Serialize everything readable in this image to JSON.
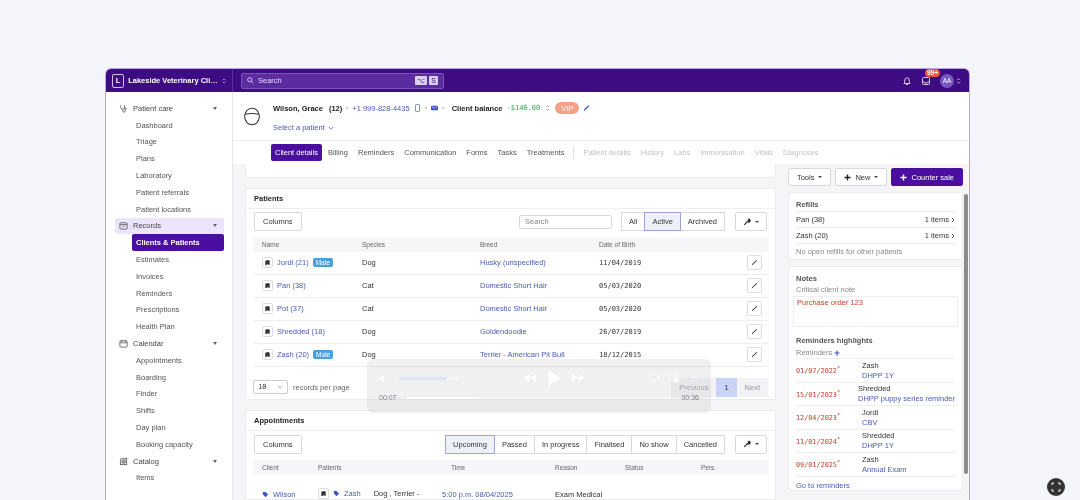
{
  "org": {
    "initial": "L",
    "name": "Lakeside Veterinary Cli…"
  },
  "search": {
    "placeholder": "Search",
    "keys": [
      "⌥",
      "S"
    ]
  },
  "notifications_badge": "99+",
  "user": {
    "initials": "AA"
  },
  "sidebar": {
    "groups": [
      {
        "label": "Patient care",
        "expanded": true,
        "selected": false,
        "items": [
          {
            "label": "Dashboard",
            "selected": false
          },
          {
            "label": "Triage",
            "selected": false
          },
          {
            "label": "Plans",
            "selected": false
          },
          {
            "label": "Laboratory",
            "selected": false
          },
          {
            "label": "Patient referrals",
            "selected": false
          },
          {
            "label": "Patient locations",
            "selected": false
          }
        ]
      },
      {
        "label": "Records",
        "expanded": true,
        "selected": true,
        "items": [
          {
            "label": "Clients & Patients",
            "selected": true
          },
          {
            "label": "Estimates",
            "selected": false
          },
          {
            "label": "Invoices",
            "selected": false
          },
          {
            "label": "Reminders",
            "selected": false
          },
          {
            "label": "Prescriptions",
            "selected": false
          },
          {
            "label": "Health Plan",
            "selected": false
          }
        ]
      },
      {
        "label": "Calendar",
        "expanded": true,
        "selected": false,
        "items": [
          {
            "label": "Appointments",
            "selected": false
          },
          {
            "label": "Boarding",
            "selected": false
          },
          {
            "label": "Finder",
            "selected": false
          },
          {
            "label": "Shifts",
            "selected": false
          },
          {
            "label": "Day plan",
            "selected": false
          },
          {
            "label": "Booking capacity",
            "selected": false
          }
        ]
      },
      {
        "label": "Catalog",
        "expanded": true,
        "selected": false,
        "items": [
          {
            "label": "Items",
            "selected": false
          }
        ]
      }
    ]
  },
  "client": {
    "name": "Wilson, Grace",
    "count": "(12)",
    "phone": "+1 999-828-4435",
    "balance_label": "Client balance",
    "balance": "-$146.00",
    "tag": "VIP",
    "patient_select": "Select a patient"
  },
  "tabs": [
    {
      "label": "Client details",
      "selected": true,
      "disabled": false
    },
    {
      "label": "Billing",
      "selected": false,
      "disabled": false
    },
    {
      "label": "Reminders",
      "selected": false,
      "disabled": false
    },
    {
      "label": "Communication",
      "selected": false,
      "disabled": false
    },
    {
      "label": "Forms",
      "selected": false,
      "disabled": false
    },
    {
      "label": "Tasks",
      "selected": false,
      "disabled": false
    },
    {
      "label": "Treatments",
      "selected": false,
      "disabled": false
    },
    {
      "label": "Patient details",
      "selected": false,
      "disabled": true
    },
    {
      "label": "History",
      "selected": false,
      "disabled": true
    },
    {
      "label": "Labs",
      "selected": false,
      "disabled": true
    },
    {
      "label": "Immunisation",
      "selected": false,
      "disabled": true
    },
    {
      "label": "Vitals",
      "selected": false,
      "disabled": true
    },
    {
      "label": "Diagnoses",
      "selected": false,
      "disabled": true
    }
  ],
  "actions": {
    "tools": "Tools",
    "new": "New",
    "counter_sale": "Counter sale"
  },
  "patients": {
    "title": "Patients",
    "columns_button": "Columns",
    "search_placeholder": "Search",
    "filters": [
      {
        "label": "All",
        "selected": false
      },
      {
        "label": "Active",
        "selected": true
      },
      {
        "label": "Archived",
        "selected": false
      }
    ],
    "columns": [
      "Name",
      "Species",
      "Breed",
      "Date of Birth"
    ],
    "rows": [
      {
        "name": "Jordi (21)",
        "tag": "Male",
        "species": "Dog",
        "breed": "Husky (unspecified)",
        "dob": "11/04/2019"
      },
      {
        "name": "Pan (38)",
        "species": "Cat",
        "breed": "Domestic Short Hair",
        "dob": "05/03/2020"
      },
      {
        "name": "Pot (37)",
        "species": "Cat",
        "breed": "Domestic Short Hair",
        "dob": "05/03/2020"
      },
      {
        "name": "Shredded (18)",
        "species": "Dog",
        "breed": "Goldendoodle",
        "dob": "26/07/2019"
      },
      {
        "name": "Zash (20)",
        "tag": "Male",
        "species": "Dog",
        "breed": "Terrier - American Pit Bull",
        "dob": "18/12/2015"
      }
    ],
    "page_size": "10",
    "page_size_label": "records per page",
    "pagination": {
      "previous": "Previous",
      "current": "1",
      "next": "Next",
      "previous_disabled": true,
      "next_disabled": true
    }
  },
  "video": {
    "elapsed": "00:07",
    "remaining": "00:36",
    "volume": {
      "level": 0.8
    },
    "progress": {
      "level": 0.25
    }
  },
  "appointments": {
    "title": "Appointments",
    "columns_button": "Columns",
    "filters": [
      {
        "label": "Upcoming",
        "selected": true
      },
      {
        "label": "Passed",
        "selected": false
      },
      {
        "label": "In progress",
        "selected": false
      },
      {
        "label": "Finalised",
        "selected": false
      },
      {
        "label": "No show",
        "selected": false
      },
      {
        "label": "Cancelled",
        "selected": false
      }
    ],
    "columns": [
      "Client",
      "Patients",
      "Time",
      "Reason",
      "Status",
      "Pers."
    ],
    "rows": [
      {
        "client": "Wilson",
        "patient": "Zash",
        "patient_detail": "Dog , Terrier -",
        "time": "5:00 p.m. 08/04/2025",
        "reason": "Exam Medical"
      }
    ]
  },
  "refills": {
    "title": "Refills",
    "rows": [
      {
        "name": "Pan (38)",
        "count": "1 items"
      },
      {
        "name": "Zash (20)",
        "count": "1 items"
      }
    ],
    "note": "No open refills for other patients"
  },
  "notes": {
    "title": "Notes",
    "critical_label": "Critical client note",
    "critical_text": "Purchase order 123",
    "reminders_title": "Reminders highlights",
    "reminders_label": "Reminders",
    "reminders": [
      {
        "date": "01/07/2022$^{*}$",
        "patient": "Zash",
        "name": "DHPP 1Y"
      },
      {
        "date": "15/01/2023$^{*}$",
        "patient": "Shredded",
        "name": "DHPP puppy series reminder"
      },
      {
        "date": "12/04/2023$^{*}$",
        "patient": "Jordi",
        "name": "CBV"
      },
      {
        "date": "11/01/2024$^{*}$",
        "patient": "Shredded",
        "name": "DHPP 1Y"
      },
      {
        "date": "09/01/2025$^{*}$",
        "patient": "Zash",
        "name": "Annual Exam"
      }
    ],
    "link": "Go to reminders"
  }
}
